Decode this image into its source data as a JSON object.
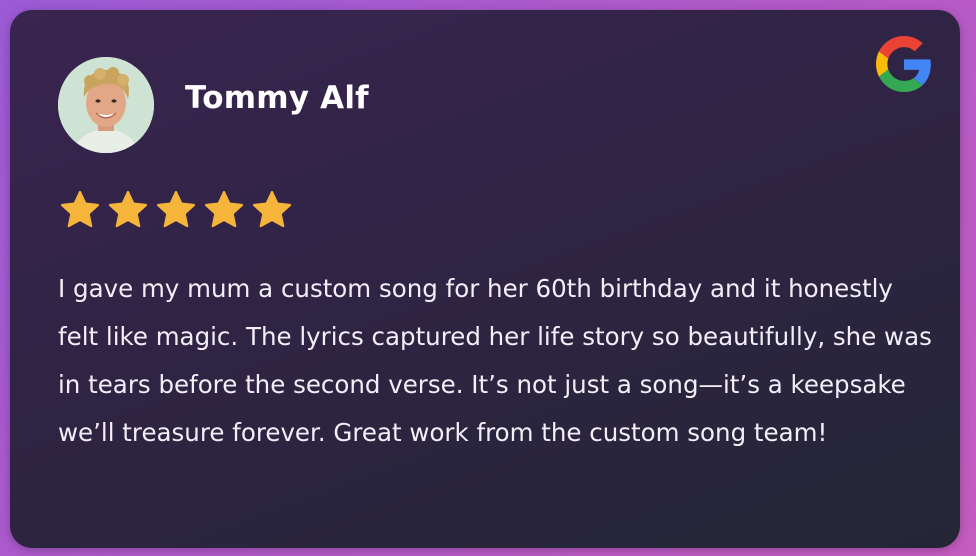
{
  "review_card": {
    "author_name": "Tommy Alf",
    "rating": 5,
    "max_rating": 5,
    "review_text": "I gave my mum a custom song for her 60th birthday and it honestly felt like magic. The lyrics captured her life story so beautifully, she was in tears before the second verse. It’s not just a song—it’s a keepsake we’ll treasure forever. Great work from the custom song team!",
    "source_icon": "google-icon",
    "star_color": "#f5b53a"
  }
}
